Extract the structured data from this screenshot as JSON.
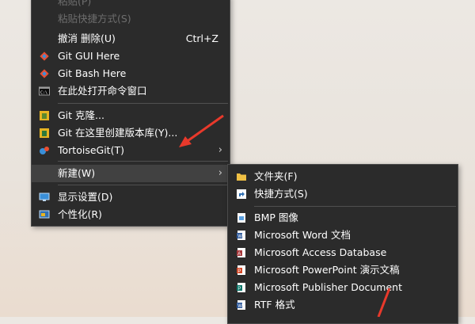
{
  "context_menu": {
    "items": [
      {
        "label": "粘贴(P)"
      },
      {
        "label": "粘贴快捷方式(S)"
      },
      {
        "label": "撤消 删除(U)",
        "shortcut": "Ctrl+Z"
      },
      {
        "label": "Git GUI Here"
      },
      {
        "label": "Git Bash Here"
      },
      {
        "label": "在此处打开命令窗口"
      },
      {
        "label": "Git 克隆..."
      },
      {
        "label": "Git 在这里创建版本库(Y)..."
      },
      {
        "label": "TortoiseGit(T)"
      },
      {
        "label": "新建(W)"
      },
      {
        "label": "显示设置(D)"
      },
      {
        "label": "个性化(R)"
      }
    ]
  },
  "submenu": {
    "items": [
      {
        "label": "文件夹(F)"
      },
      {
        "label": "快捷方式(S)"
      },
      {
        "label": "BMP 图像"
      },
      {
        "label": "Microsoft Word 文档"
      },
      {
        "label": "Microsoft Access Database"
      },
      {
        "label": "Microsoft PowerPoint 演示文稿"
      },
      {
        "label": "Microsoft Publisher Document"
      },
      {
        "label": "RTF 格式"
      }
    ]
  },
  "colors": {
    "menu_bg": "#2b2b2b",
    "highlight": "#414141",
    "annotation_arrow": "#e8392b"
  },
  "icons": {
    "git_gui": "git-diamond-icon",
    "git_bash": "git-diamond-icon",
    "cmd": "terminal-icon",
    "git_clone": "git-clone-icon",
    "git_create": "git-repo-icon",
    "tortoisegit": "tortoise-icon",
    "display": "monitor-icon",
    "personalize": "personalize-icon",
    "folder": "folder-icon",
    "shortcut": "shortcut-icon",
    "bmp": "bmp-icon",
    "word": "word-doc-icon",
    "access": "access-db-icon",
    "powerpoint": "powerpoint-icon",
    "publisher": "publisher-icon",
    "rtf": "rtf-doc-icon"
  }
}
